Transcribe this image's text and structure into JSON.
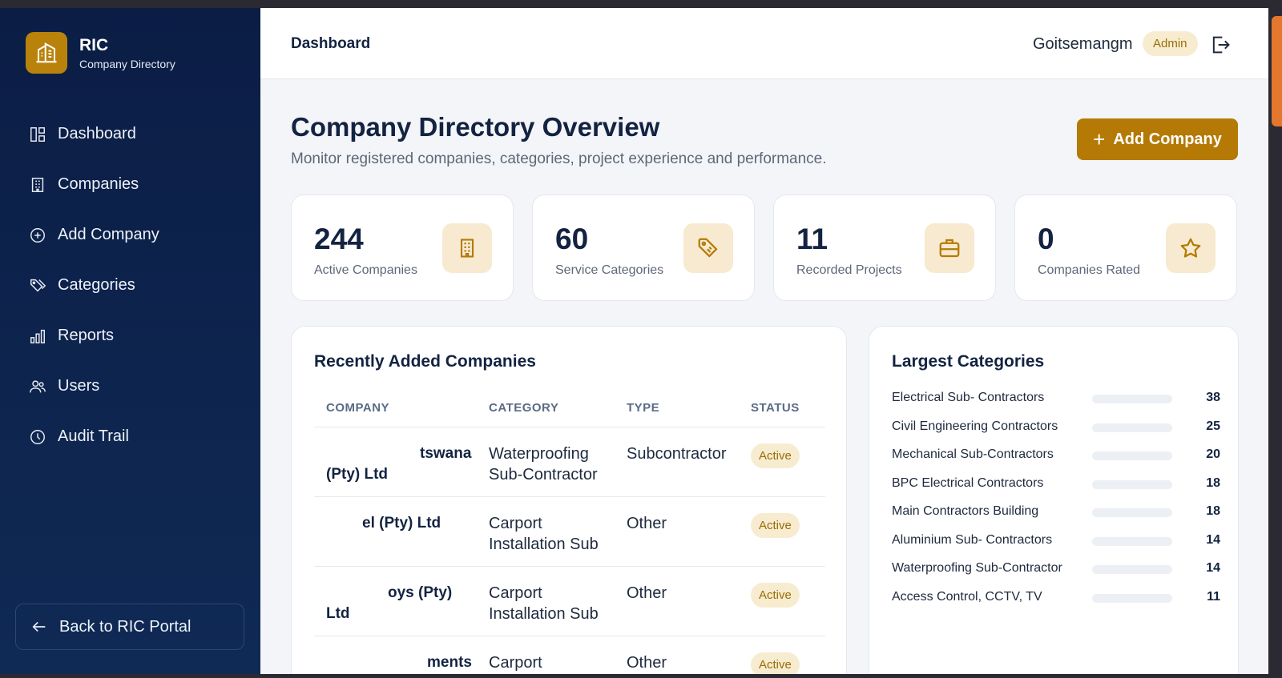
{
  "brand": {
    "title": "RIC",
    "subtitle": "Company Directory"
  },
  "sidebar": {
    "items": [
      {
        "label": "Dashboard",
        "icon": "dashboard-icon"
      },
      {
        "label": "Companies",
        "icon": "building-icon"
      },
      {
        "label": "Add Company",
        "icon": "plus-circle-icon"
      },
      {
        "label": "Categories",
        "icon": "tags-icon"
      },
      {
        "label": "Reports",
        "icon": "bar-chart-icon"
      },
      {
        "label": "Users",
        "icon": "users-icon"
      },
      {
        "label": "Audit Trail",
        "icon": "clock-icon"
      }
    ],
    "back_label": "Back to RIC Portal"
  },
  "header": {
    "title": "Dashboard",
    "user": "Goitsemangm",
    "role": "Admin"
  },
  "main": {
    "title": "Company Directory Overview",
    "subtitle": "Monitor registered companies, categories, project experience and performance.",
    "add_button": "Add Company"
  },
  "stats": [
    {
      "value": "244",
      "label": "Active Companies",
      "icon": "building-icon"
    },
    {
      "value": "60",
      "label": "Service Categories",
      "icon": "tag-icon"
    },
    {
      "value": "11",
      "label": "Recorded Projects",
      "icon": "briefcase-icon"
    },
    {
      "value": "0",
      "label": "Companies Rated",
      "icon": "star-icon"
    }
  ],
  "recent": {
    "title": "Recently Added Companies",
    "columns": [
      "COMPANY",
      "CATEGORY",
      "TYPE",
      "STATUS"
    ],
    "rows": [
      {
        "company_a": "tswana",
        "company_b": "(Pty) Ltd",
        "category_a": "Waterproofing",
        "category_b": "Sub-Contractor",
        "type": "Subcontractor",
        "status": "Active"
      },
      {
        "company_a": "el (Pty) Ltd",
        "company_b": "",
        "category_a": "Carport",
        "category_b": "Installation Sub",
        "type": "Other",
        "status": "Active"
      },
      {
        "company_a": "oys (Pty)",
        "company_b": "Ltd",
        "category_a": "Carport",
        "category_b": "Installation Sub",
        "type": "Other",
        "status": "Active"
      },
      {
        "company_a": "ments",
        "company_b": "",
        "category_a": "Carport",
        "category_b": "",
        "type": "Other",
        "status": "Active"
      }
    ]
  },
  "categories": {
    "title": "Largest Categories",
    "items": [
      {
        "name": "Electrical Sub- Contractors",
        "count": "38"
      },
      {
        "name": "Civil Engineering Contractors",
        "count": "25"
      },
      {
        "name": "Mechanical Sub-Contractors",
        "count": "20"
      },
      {
        "name": "BPC Electrical Contractors",
        "count": "18"
      },
      {
        "name": "Main Contractors Building",
        "count": "18"
      },
      {
        "name": "Aluminium Sub- Contractors",
        "count": "14"
      },
      {
        "name": "Waterproofing Sub-Contractor",
        "count": "14"
      },
      {
        "name": "Access Control, CCTV, TV",
        "count": "11"
      }
    ]
  },
  "colors": {
    "sidebar": "#0b1d45",
    "accent": "#b47a05",
    "badge_bg": "#f7ecd0",
    "badge_text": "#9a6d05"
  }
}
